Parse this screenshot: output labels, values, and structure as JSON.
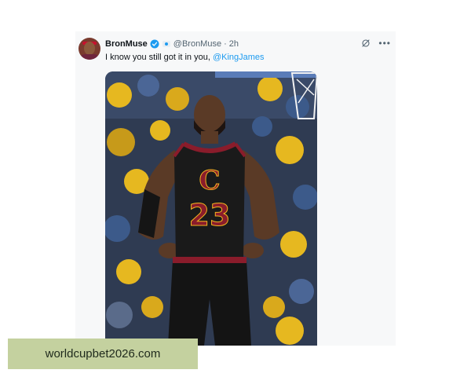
{
  "tweet": {
    "display_name": "BronMuse",
    "handle": "@BronMuse",
    "separator": "·",
    "time": "2h",
    "text": "I know you still got it in you, ",
    "mention": "@KingJames",
    "icons": [
      "verified-badge-icon",
      "affiliate-badge-icon",
      "grok-icon",
      "more-options-icon"
    ],
    "more_label": "•••"
  },
  "photo": {
    "jersey_logo": "C",
    "jersey_number": "23",
    "colors": {
      "jersey": "#1a1a1a",
      "trim": "#8a1c2b",
      "gold": "#f2b320",
      "crowd_yellow": "#e6b820",
      "crowd_blue": "#3c5a8a"
    }
  },
  "watermark": {
    "text": "worldcupbet2026.com"
  },
  "colors": {
    "accent": "#1d9bf0",
    "text_primary": "#0f1419",
    "text_secondary": "#536471",
    "watermark_bg": "#c4d19f"
  }
}
